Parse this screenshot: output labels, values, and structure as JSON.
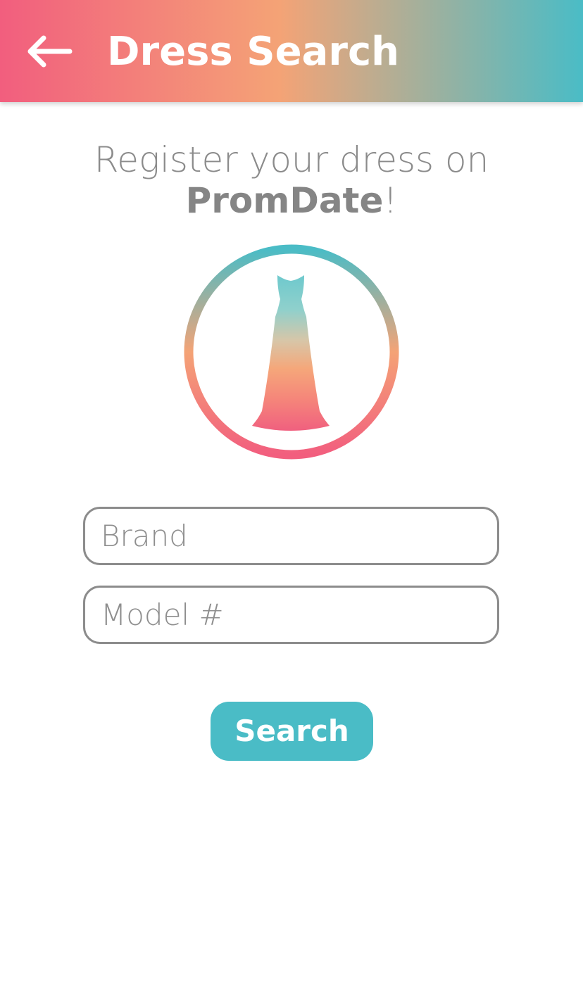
{
  "app_bar": {
    "title": "Dress Search",
    "back_icon": "arrow-left-icon",
    "gradient": [
      "#f25e7e",
      "#f4a376",
      "#b8ad92",
      "#4abcc6"
    ]
  },
  "heading": {
    "line1": "Register your dress on",
    "brand": "PromDate",
    "suffix": "!"
  },
  "logo": {
    "icon": "dress-icon",
    "ring_colors": [
      "#4abcc6",
      "#f4a376",
      "#f25e7e"
    ]
  },
  "form": {
    "brand": {
      "placeholder": "Brand",
      "value": ""
    },
    "model": {
      "placeholder": "Model #",
      "value": ""
    },
    "search_label": "Search"
  },
  "colors": {
    "accent": "#4abcc6",
    "text_gray": "#8b8b8b",
    "border_gray": "#8c8c8c"
  }
}
